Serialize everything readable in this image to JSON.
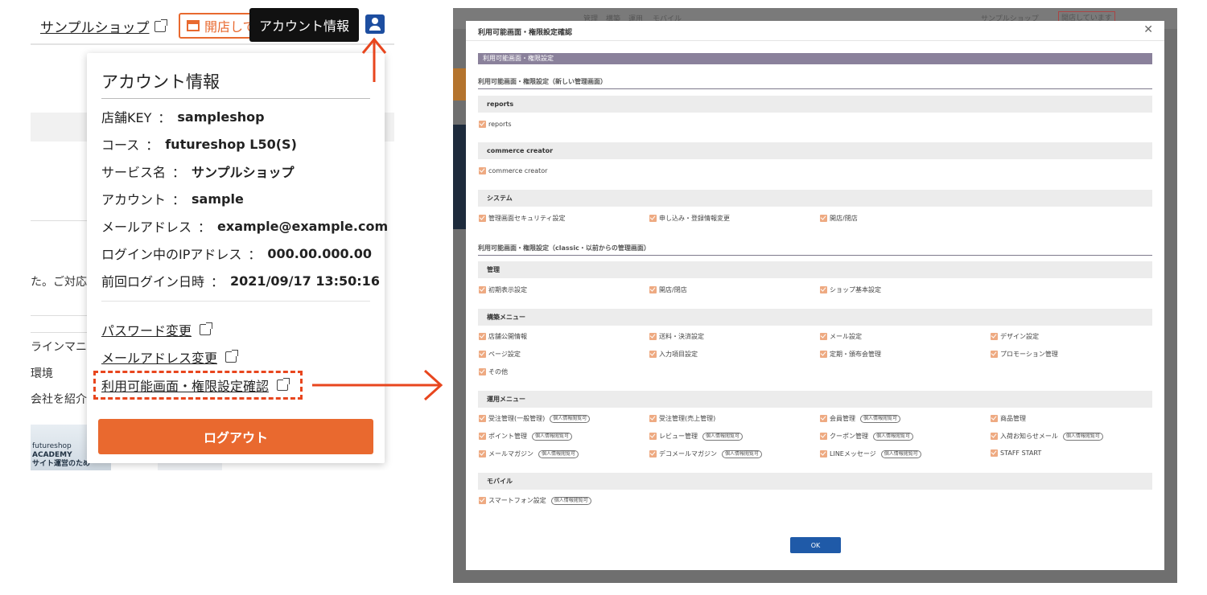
{
  "left_panel": {
    "shop_link": "サンプルショップ",
    "open_button": "開店して",
    "tooltip": "アカウント情報",
    "background_texts": [
      "た。ご対応",
      "ラインマニュ",
      "環境",
      "会社を紹介し"
    ],
    "background_image_text": [
      "futureshop",
      "ACADEMY",
      "サイト運営のため"
    ],
    "popup": {
      "title": "アカウント情報",
      "rows": [
        {
          "label": "店舗KEY",
          "sep": "：",
          "value": "sampleshop"
        },
        {
          "label": "コース",
          "sep": "：",
          "value": "futureshop L50(S)"
        },
        {
          "label": "サービス名",
          "sep": "：",
          "value": "サンプルショップ"
        },
        {
          "label": "アカウント",
          "sep": "：",
          "value": "sample"
        },
        {
          "label": "メールアドレス",
          "sep": "：",
          "value": "example@example.com"
        },
        {
          "label": "ログイン中のIPアドレス",
          "sep": "：",
          "value": "000.00.000.00"
        },
        {
          "label": "前回ログイン日時",
          "sep": "：",
          "value": "2021/09/17 13:50:16"
        }
      ],
      "links": [
        "パスワード変更",
        "メールアドレス変更",
        "利用可能画面・権限設定確認"
      ],
      "logout": "ログアウト"
    }
  },
  "right_panel": {
    "nav": [
      "管理",
      "構築",
      "運用",
      "モバイル"
    ],
    "nav_right": "サンプルショップ",
    "nav_right_button": "開店しています",
    "modal": {
      "title": "利用可能画面・権限設定確認",
      "close": "✕",
      "banner": "利用可能画面・権限設定",
      "section1": "利用可能画面・権限設定（新しい管理画面）",
      "section2": "利用可能画面・権限設定（classic・以前からの管理画面）",
      "groups": [
        {
          "name": "reports",
          "rows": [
            [
              {
                "label": "reports"
              }
            ]
          ]
        },
        {
          "name": "commerce creator",
          "rows": [
            [
              {
                "label": "commerce creator"
              }
            ]
          ]
        },
        {
          "name": "システム",
          "rows": [
            [
              {
                "label": "管理画面セキュリティ設定"
              },
              {
                "label": "申し込み・登録情報変更"
              },
              {
                "label": "開店/閉店"
              }
            ]
          ]
        },
        {
          "name": "管理",
          "rows": [
            [
              {
                "label": "初期表示設定"
              },
              {
                "label": "開店/閉店"
              },
              {
                "label": "ショップ基本設定"
              }
            ]
          ]
        },
        {
          "name": "構築メニュー",
          "rows": [
            [
              {
                "label": "店舗公開情報"
              },
              {
                "label": "送料・決済設定"
              },
              {
                "label": "メール設定"
              },
              {
                "label": "デザイン設定"
              }
            ],
            [
              {
                "label": "ページ設定"
              },
              {
                "label": "入力項目設定"
              },
              {
                "label": "定期・頒布会管理"
              },
              {
                "label": "プロモーション管理"
              }
            ],
            [
              {
                "label": "その他"
              }
            ]
          ]
        },
        {
          "name": "運用メニュー",
          "rows": [
            [
              {
                "label": "受注管理(一般管理)",
                "tag": "個人情報閲覧可"
              },
              {
                "label": "受注管理(売上管理)"
              },
              {
                "label": "会員管理",
                "tag": "個人情報閲覧可"
              },
              {
                "label": "商品管理"
              }
            ],
            [
              {
                "label": "ポイント管理",
                "tag": "個人情報閲覧可"
              },
              {
                "label": "レビュー管理",
                "tag": "個人情報閲覧可"
              },
              {
                "label": "クーポン管理",
                "tag": "個人情報閲覧可"
              },
              {
                "label": "入荷お知らせメール",
                "tag": "個人情報閲覧可"
              }
            ],
            [
              {
                "label": "メールマガジン",
                "tag": "個人情報閲覧可"
              },
              {
                "label": "デコメールマガジン",
                "tag": "個人情報閲覧可"
              },
              {
                "label": "LINEメッセージ",
                "tag": "個人情報閲覧可"
              },
              {
                "label": "STAFF START"
              }
            ]
          ]
        },
        {
          "name": "モバイル",
          "rows": [
            [
              {
                "label": "スマートフォン設定",
                "tag": "個人情報閲覧可"
              }
            ]
          ]
        }
      ],
      "ok": "OK"
    }
  },
  "colors": {
    "accent_orange": "#e9692f",
    "highlight_red": "#e8461e",
    "user_blue": "#1d4ea0",
    "ok_blue": "#1f5aa8",
    "banner_purple": "#8a819b",
    "checkbox": "#eeaa82"
  }
}
